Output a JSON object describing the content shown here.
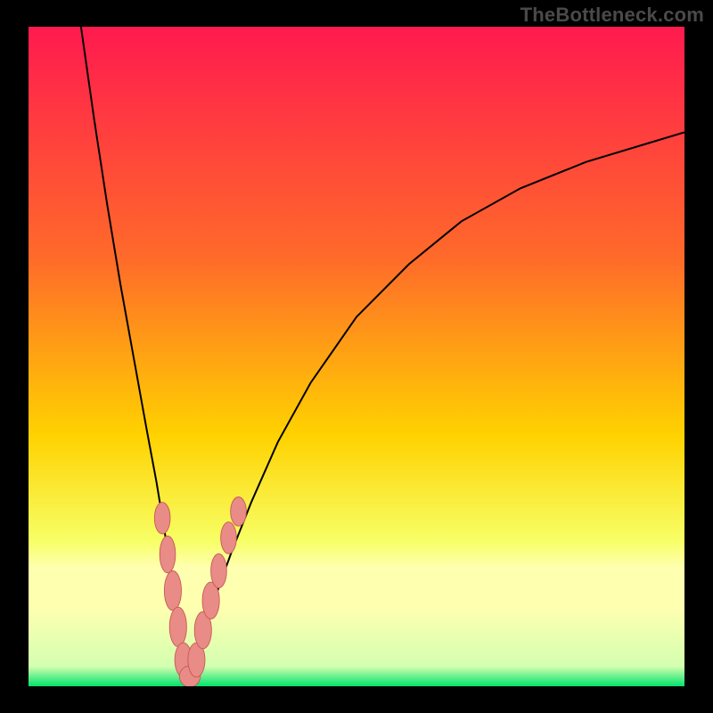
{
  "watermark": "TheBottleneck.com",
  "colors": {
    "frame": "#000000",
    "watermark_text": "#4a4a4a",
    "gradient_top": "#ff1a4f",
    "gradient_mid1": "#ff6a2a",
    "gradient_mid2": "#ffd200",
    "gradient_low": "#f7ff66",
    "gradient_band": "#ffffb0",
    "gradient_bottom": "#00e36b",
    "curve": "#000000",
    "marker_fill": "#e98b86",
    "marker_stroke": "#c55a55"
  },
  "chart_data": {
    "type": "line",
    "title": "",
    "xlabel": "",
    "ylabel": "",
    "xlim": [
      0,
      100
    ],
    "ylim": [
      0,
      100
    ],
    "grid": false,
    "legend": false,
    "curve_left": {
      "x": [
        8,
        10,
        12,
        14,
        16,
        18,
        19.5,
        20.5,
        21.3,
        22,
        22.5,
        23,
        23.4,
        23.8,
        24.2
      ],
      "y": [
        100,
        86,
        73,
        61,
        50,
        39,
        31,
        25,
        20,
        15.5,
        12,
        8.5,
        5.5,
        3,
        1
      ]
    },
    "curve_right": {
      "x": [
        24.2,
        25,
        26,
        27.5,
        29,
        31,
        34,
        38,
        43,
        50,
        58,
        66,
        75,
        85,
        95,
        100
      ],
      "y": [
        1,
        3,
        6,
        10.5,
        15,
        20.5,
        28,
        37,
        46,
        56,
        64,
        70.5,
        75.5,
        79.5,
        82.5,
        84
      ]
    },
    "markers": [
      {
        "x": 20.4,
        "y": 25.5,
        "rx": 1.2,
        "ry": 2.4
      },
      {
        "x": 21.2,
        "y": 20.0,
        "rx": 1.2,
        "ry": 2.8
      },
      {
        "x": 22.0,
        "y": 14.5,
        "rx": 1.3,
        "ry": 3.0
      },
      {
        "x": 22.8,
        "y": 9.0,
        "rx": 1.3,
        "ry": 3.0
      },
      {
        "x": 23.6,
        "y": 4.0,
        "rx": 1.3,
        "ry": 2.6
      },
      {
        "x": 24.6,
        "y": 1.5,
        "rx": 1.6,
        "ry": 1.6
      },
      {
        "x": 25.6,
        "y": 4.0,
        "rx": 1.3,
        "ry": 2.6
      },
      {
        "x": 26.6,
        "y": 8.5,
        "rx": 1.3,
        "ry": 2.8
      },
      {
        "x": 27.8,
        "y": 13.0,
        "rx": 1.3,
        "ry": 2.8
      },
      {
        "x": 29.0,
        "y": 17.5,
        "rx": 1.2,
        "ry": 2.6
      },
      {
        "x": 30.5,
        "y": 22.5,
        "rx": 1.2,
        "ry": 2.4
      },
      {
        "x": 32.0,
        "y": 26.5,
        "rx": 1.2,
        "ry": 2.2
      }
    ]
  }
}
